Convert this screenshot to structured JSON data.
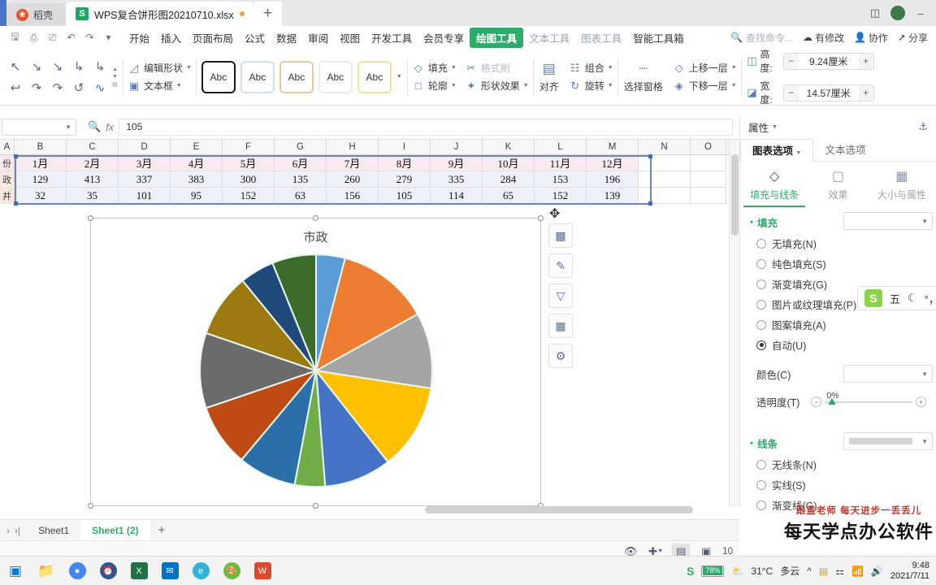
{
  "tabbar": {
    "daoke_label": "稻壳",
    "daoke_icon": "flame-icon",
    "doc_title": "WPS复合饼形图20210710.xlsx",
    "doc_icon": "excel-file-icon",
    "new_tab": "+"
  },
  "menu": {
    "quick_access": [
      "save-icon",
      "print-icon",
      "print-preview-icon",
      "undo-icon",
      "redo-icon",
      "dropdown-icon"
    ],
    "items": [
      {
        "label": "开始",
        "active": false
      },
      {
        "label": "插入",
        "active": false
      },
      {
        "label": "页面布局",
        "active": false
      },
      {
        "label": "公式",
        "active": false
      },
      {
        "label": "数据",
        "active": false
      },
      {
        "label": "审阅",
        "active": false
      },
      {
        "label": "视图",
        "active": false
      },
      {
        "label": "开发工具",
        "active": false
      },
      {
        "label": "会员专享",
        "active": false
      },
      {
        "label": "绘图工具",
        "active": true
      },
      {
        "label": "文本工具",
        "active": false,
        "dim": true
      },
      {
        "label": "图表工具",
        "active": false,
        "dim": true
      },
      {
        "label": "智能工具箱",
        "active": false
      }
    ],
    "search_placeholder": "查找命令...",
    "right_items": [
      {
        "label": "有修改",
        "icon": "cloud-sync-icon"
      },
      {
        "label": "协作",
        "icon": "collaborate-icon"
      },
      {
        "label": "分享",
        "icon": "share-icon"
      }
    ]
  },
  "toolbar": {
    "shape_glyphs": [
      "↖",
      "↘",
      "↖",
      "↳",
      "⤴",
      "↩",
      "↷",
      "↺",
      "↻",
      "∿"
    ],
    "edit_shape": "编辑形状",
    "text_box": "文本框",
    "styles": [
      "Abc",
      "Abc",
      "Abc",
      "Abc",
      "Abc"
    ],
    "fill": "填充",
    "format_painter": "格式刷",
    "outline": "轮廓",
    "shape_effect": "形状效果",
    "align": "对齐",
    "group": "组合",
    "rotate": "旋转",
    "select_pane": "选择窗格",
    "bring_forward": "上移一层",
    "send_backward": "下移一层",
    "height_label": "高度:",
    "height_value": "9.24厘米",
    "width_label": "宽度:",
    "width_value": "14.57厘米",
    "minus": "−",
    "plus": "+"
  },
  "formula_bar": {
    "name_box": "",
    "fx_label": "fx",
    "value": "105"
  },
  "grid": {
    "columns": [
      "A",
      "B",
      "C",
      "D",
      "E",
      "F",
      "G",
      "H",
      "I",
      "J",
      "K",
      "L",
      "M",
      "N",
      "O"
    ],
    "rows": [
      {
        "header": "份",
        "cells": [
          "1月",
          "2月",
          "3月",
          "4月",
          "5月",
          "6月",
          "7月",
          "8月",
          "9月",
          "10月",
          "11月",
          "12月",
          "",
          ""
        ],
        "style": "month"
      },
      {
        "header": "政",
        "cells": [
          "129",
          "413",
          "337",
          "383",
          "300",
          "135",
          "260",
          "279",
          "335",
          "284",
          "153",
          "196",
          "",
          ""
        ],
        "style": "a"
      },
      {
        "header": "井",
        "cells": [
          "32",
          "35",
          "101",
          "95",
          "152",
          "63",
          "156",
          "105",
          "114",
          "65",
          "152",
          "139",
          "",
          ""
        ],
        "style": "b"
      }
    ]
  },
  "chart": {
    "title": "市政",
    "tools": [
      {
        "name": "chart-elements",
        "glyph": "Ὄa"
      },
      {
        "name": "chart-style",
        "glyph": "✎"
      },
      {
        "name": "chart-filter",
        "glyph": "▽"
      },
      {
        "name": "chart-type",
        "glyph": "☷"
      },
      {
        "name": "chart-settings",
        "glyph": "⚙"
      }
    ]
  },
  "chart_data": {
    "type": "pie",
    "title": "市政",
    "categories": [
      "1月",
      "2月",
      "3月",
      "4月",
      "5月",
      "6月",
      "7月",
      "8月",
      "9月",
      "10月",
      "11月",
      "12月"
    ],
    "values": [
      129,
      413,
      337,
      383,
      300,
      135,
      260,
      279,
      335,
      284,
      153,
      196
    ],
    "colors": [
      "#5b9bd5",
      "#ed7d31",
      "#a5a5a5",
      "#ffc000",
      "#4472c4",
      "#70ad47",
      "#2a6fa8",
      "#be4b14",
      "#6b6b6b",
      "#9c7a10",
      "#1f4a7a",
      "#3a6b28"
    ],
    "xlabel": "",
    "ylabel": "",
    "legend": "none",
    "series_name": "市政",
    "second_series": {
      "name": "井",
      "values": [
        32,
        35,
        101,
        95,
        152,
        63,
        156,
        105,
        114,
        65,
        152,
        139
      ]
    }
  },
  "sheets": {
    "nav": [
      "›",
      "⊳|"
    ],
    "tabs": [
      {
        "label": "Sheet1",
        "active": false
      },
      {
        "label": "Sheet1 (2)",
        "active": true
      }
    ],
    "add": "+"
  },
  "status": {
    "eye_icon": "eye-icon",
    "move_icon": "move-icon",
    "view_normal": "grid-view-icon",
    "view_page": "page-view-icon",
    "zoom": "10"
  },
  "props": {
    "title": "属性",
    "pin_icon": "pin-icon",
    "tabs": [
      {
        "label": "图表选项",
        "active": true
      },
      {
        "label": "文本选项",
        "active": false
      }
    ],
    "subtabs": [
      {
        "label": "填充与线条",
        "icon": "fill-line-icon",
        "active": true
      },
      {
        "label": "效果",
        "icon": "effects-icon",
        "active": false
      },
      {
        "label": "大小与属性",
        "icon": "size-props-icon",
        "active": false
      }
    ],
    "fill_section": "填充",
    "fill_options": [
      {
        "label": "无填充(N)",
        "selected": false
      },
      {
        "label": "纯色填充(S)",
        "selected": false
      },
      {
        "label": "渐变填充(G)",
        "selected": false
      },
      {
        "label": "图片或纹理填充(P)",
        "selected": false
      },
      {
        "label": "图案填充(A)",
        "selected": false
      },
      {
        "label": "自动(U)",
        "selected": true
      }
    ],
    "color_label": "颜色(C)",
    "transparency_label": "透明度(T)",
    "transparency_value": "0%",
    "line_section": "线条",
    "line_options": [
      {
        "label": "无线条(N)",
        "selected": false
      },
      {
        "label": "实线(S)",
        "selected": false
      },
      {
        "label": "渐变线(G)",
        "selected": false
      }
    ]
  },
  "ime": {
    "logo": "S",
    "items": [
      "五",
      "☾",
      "°，",
      "⌨"
    ]
  },
  "watermark": {
    "line1": "跟盖老师  每天进步一丢丢儿",
    "line2": "每天学点办公软件"
  },
  "taskbar": {
    "icons": [
      "windows-start-icon",
      "folder-icon",
      "chrome-icon",
      "clock-icon",
      "excel-icon",
      "mail-icon",
      "edge-icon",
      "paint-icon",
      "wps-icon"
    ],
    "tray_s": "S",
    "battery": "78%",
    "temperature": "31°C",
    "weather": "多云",
    "time": "9:48",
    "date": "2021/7/11"
  }
}
